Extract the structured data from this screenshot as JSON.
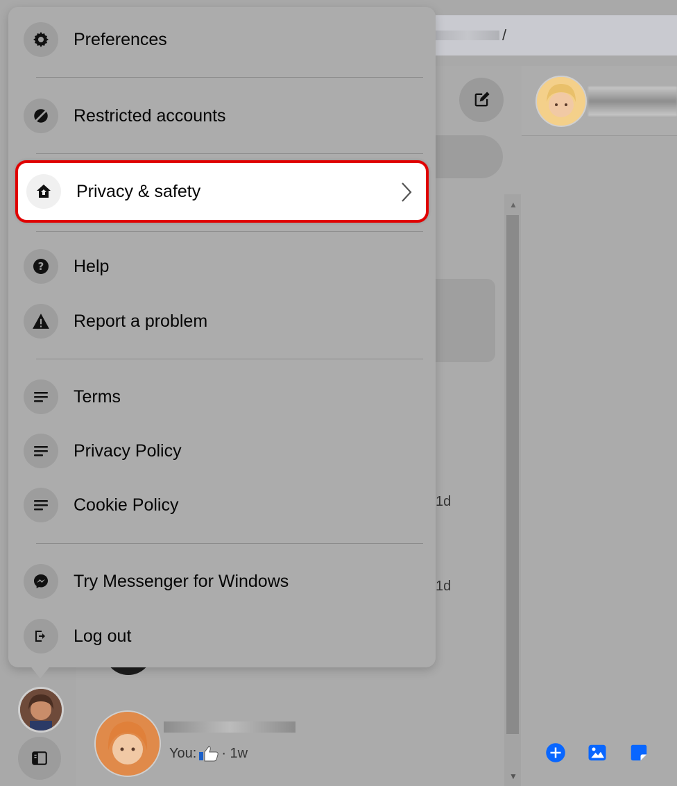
{
  "menu": {
    "items": [
      {
        "label": "Preferences",
        "icon": "gear-icon"
      },
      {
        "label": "Restricted accounts",
        "icon": "restricted-icon"
      },
      {
        "label": "Privacy & safety",
        "icon": "privacy-house-icon",
        "selected": true
      },
      {
        "label": "Help",
        "icon": "help-icon"
      },
      {
        "label": "Report a problem",
        "icon": "warning-icon"
      },
      {
        "label": "Terms",
        "icon": "lines-icon"
      },
      {
        "label": "Privacy Policy",
        "icon": "lines-icon"
      },
      {
        "label": "Cookie Policy",
        "icon": "lines-icon"
      },
      {
        "label": "Try Messenger for Windows",
        "icon": "messenger-icon"
      },
      {
        "label": "Log out",
        "icon": "logout-icon"
      }
    ]
  },
  "background": {
    "address_fragment": "/",
    "timestamps": [
      "1d",
      "1d"
    ],
    "conversation": {
      "preview_prefix": "You:",
      "preview_suffix": "· 1w"
    }
  },
  "colors": {
    "highlight_border": "#e00000",
    "accent": "#0866ff"
  }
}
